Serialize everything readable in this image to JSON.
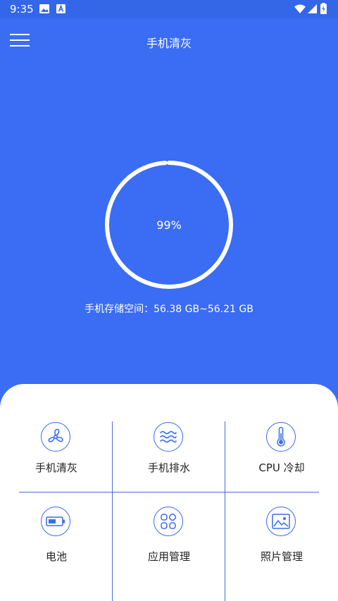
{
  "status_bar": {
    "time": "9:35"
  },
  "app_bar": {
    "title": "手机清灰"
  },
  "gauge": {
    "percent_label": "99%",
    "progress": 0.99
  },
  "storage": {
    "text": "手机存储空间：56.38 GB~56.21 GB"
  },
  "grid": {
    "items": [
      {
        "label": "手机清灰",
        "icon": "fan-icon"
      },
      {
        "label": "手机排水",
        "icon": "water-waves-icon"
      },
      {
        "label": "CPU 冷却",
        "icon": "thermometer-icon"
      },
      {
        "label": "电池",
        "icon": "battery-icon"
      },
      {
        "label": "应用管理",
        "icon": "apps-grid-icon"
      },
      {
        "label": "照片管理",
        "icon": "photo-icon"
      }
    ]
  },
  "colors": {
    "accent": "#3a6cf4",
    "statusbar": "#3367e8",
    "panel": "#ffffff",
    "divider": "#4a6bd8"
  }
}
